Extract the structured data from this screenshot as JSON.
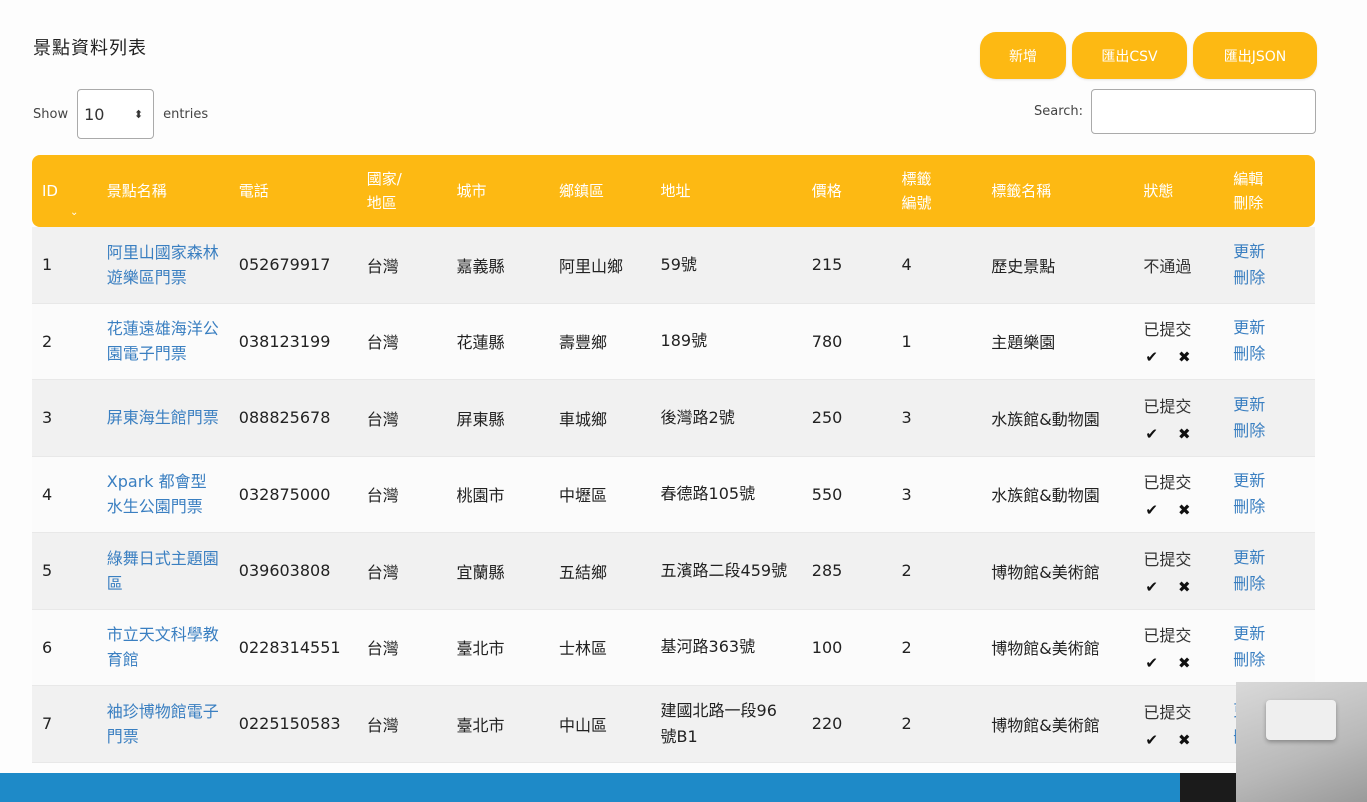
{
  "page": {
    "title": "景點資料列表"
  },
  "toolbar": {
    "new_label": "新增",
    "export_csv_label": "匯出CSV",
    "export_json_label": "匯出JSON"
  },
  "length_control": {
    "prefix": "Show",
    "value": "10",
    "suffix": "entries"
  },
  "search": {
    "label": "Search:",
    "value": ""
  },
  "table": {
    "headers": [
      "ID",
      "景點名稱",
      "電話",
      "國家/地區",
      "城市",
      "鄉鎮區",
      "地址",
      "價格",
      "標籤編號",
      "標籤名稱",
      "狀態",
      "編輯刪除"
    ],
    "rows": [
      {
        "id": "1",
        "name": "阿里山國家森林遊樂區門票",
        "phone": "052679917",
        "country": "台灣",
        "city": "嘉義縣",
        "district": "阿里山鄉",
        "address": "59號",
        "price": "215",
        "tag_id": "4",
        "tag_name": "歷史景點",
        "status": "不通過",
        "show_actions": false,
        "edit": "更新",
        "delete": "刪除"
      },
      {
        "id": "2",
        "name": "花蓮遠雄海洋公園電子門票",
        "phone": "038123199",
        "country": "台灣",
        "city": "花蓮縣",
        "district": "壽豐鄉",
        "address": "189號",
        "price": "780",
        "tag_id": "1",
        "tag_name": "主題樂園",
        "status": "已提交",
        "show_actions": true,
        "edit": "更新",
        "delete": "刪除"
      },
      {
        "id": "3",
        "name": "屏東海生館門票",
        "phone": "088825678",
        "country": "台灣",
        "city": "屏東縣",
        "district": "車城鄉",
        "address": "後灣路2號",
        "price": "250",
        "tag_id": "3",
        "tag_name": "水族館&動物園",
        "status": "已提交",
        "show_actions": true,
        "edit": "更新",
        "delete": "刪除"
      },
      {
        "id": "4",
        "name": "Xpark 都會型水生公園門票",
        "phone": "032875000",
        "country": "台灣",
        "city": "桃園市",
        "district": "中壢區",
        "address": "春德路105號",
        "price": "550",
        "tag_id": "3",
        "tag_name": "水族館&動物園",
        "status": "已提交",
        "show_actions": true,
        "edit": "更新",
        "delete": "刪除"
      },
      {
        "id": "5",
        "name": "綠舞日式主題園區",
        "phone": "039603808",
        "country": "台灣",
        "city": "宜蘭縣",
        "district": "五結鄉",
        "address": "五濱路二段459號",
        "price": "285",
        "tag_id": "2",
        "tag_name": "博物館&美術館",
        "status": "已提交",
        "show_actions": true,
        "edit": "更新",
        "delete": "刪除"
      },
      {
        "id": "6",
        "name": "市立天文科學教育館",
        "phone": "0228314551",
        "country": "台灣",
        "city": "臺北市",
        "district": "士林區",
        "address": "基河路363號",
        "price": "100",
        "tag_id": "2",
        "tag_name": "博物館&美術館",
        "status": "已提交",
        "show_actions": true,
        "edit": "更新",
        "delete": "刪除"
      },
      {
        "id": "7",
        "name": "袖珍博物館電子門票",
        "phone": "0225150583",
        "country": "台灣",
        "city": "臺北市",
        "district": "中山區",
        "address": "建國北路一段96號B1",
        "price": "220",
        "tag_id": "2",
        "tag_name": "博物館&美術館",
        "status": "已提交",
        "show_actions": true,
        "edit": "更新",
        "delete": "刪除"
      }
    ]
  },
  "icons": {
    "approve": "check-icon",
    "reject": "close-icon",
    "sort": "chevron-down-icon",
    "select": "sort-caret-icon"
  },
  "colors": {
    "accent": "#fdb913",
    "link": "#3a7fc1",
    "footer": "#1e8ac8"
  }
}
